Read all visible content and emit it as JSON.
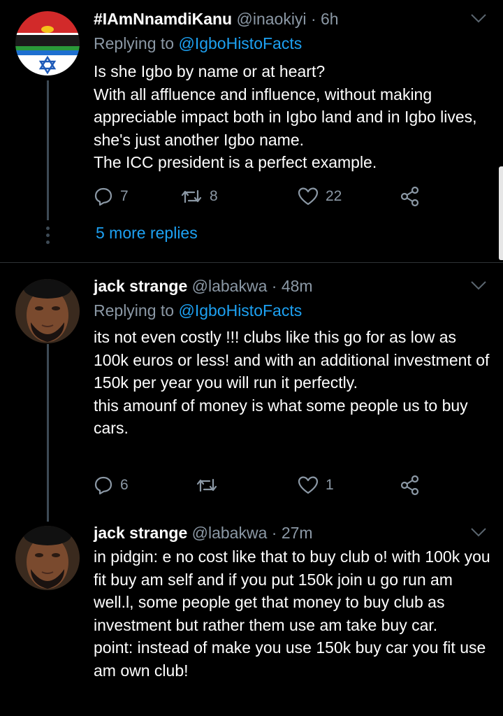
{
  "tweets": [
    {
      "name": "#IAmNnamdiKanu",
      "handle": "@inaokiyi",
      "sep": "·",
      "time": "6h",
      "replying_prefix": "Replying to",
      "replying_to": "@IgboHistoFacts",
      "text": "Is she Igbo by name or at heart?\nWith all affluence and influence, without making appreciable impact both in Igbo land and in Igbo lives, she's just another Igbo name.\nThe ICC president is a perfect example.",
      "replies": "7",
      "retweets": "8",
      "likes": "22",
      "avatar_icon": "biafra-flag-star-of-david-icon"
    },
    {
      "name": "jack strange",
      "handle": "@labakwa",
      "sep": "·",
      "time": "48m",
      "replying_prefix": "Replying to",
      "replying_to": "@IgboHistoFacts",
      "text": "its not even costly !!! clubs like this go for as low as 100k euros or less! and with an additional investment  of 150k per year you will run it perfectly.\nthis amounf of money is what some people us to buy cars.",
      "replies": "6",
      "retweets": "",
      "likes": "1",
      "avatar_icon": "user-portrait-photo"
    },
    {
      "name": "jack strange",
      "handle": "@labakwa",
      "sep": "·",
      "time": "27m",
      "text": "in pidgin: e no cost like that to buy club o! with 100k you fit buy am self and if you put 150k join u go run am well.l, some people get that money to buy club as investment but rather them use am take buy car.\npoint: instead of make you use 150k buy car you fit use am own club!",
      "avatar_icon": "user-portrait-photo"
    }
  ],
  "more_replies": "5 more replies",
  "colors": {
    "background": "#000000",
    "secondary_text": "#8b98a5",
    "link": "#1da1f2",
    "thread_line": "#3d4a55"
  }
}
